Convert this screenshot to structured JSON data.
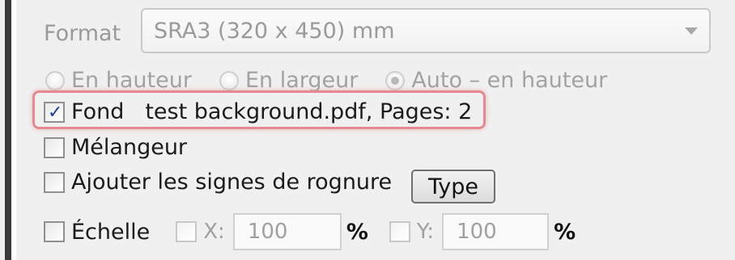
{
  "format": {
    "label": "Format",
    "value": "SRA3 (320 x 450) mm"
  },
  "orientation": {
    "options": [
      {
        "label": "En hauteur",
        "checked": false
      },
      {
        "label": "En largeur",
        "checked": false
      },
      {
        "label": "Auto – en hauteur",
        "checked": true
      }
    ]
  },
  "fond": {
    "label": "Fond",
    "checked": true,
    "detail": "test background.pdf, Pages: 2"
  },
  "melangeur": {
    "label": "Mélangeur",
    "checked": false
  },
  "rognure": {
    "label": "Ajouter les signes de rognure",
    "checked": false,
    "type_button": "Type"
  },
  "echelle": {
    "label": "Échelle",
    "checked": false,
    "x_label": "X:",
    "x_value": "100",
    "x_unit": "%",
    "y_label": "Y:",
    "y_value": "100",
    "y_unit": "%"
  },
  "colors": {
    "highlight": "#e48a8f",
    "checkmark": "#1f3f8f"
  }
}
